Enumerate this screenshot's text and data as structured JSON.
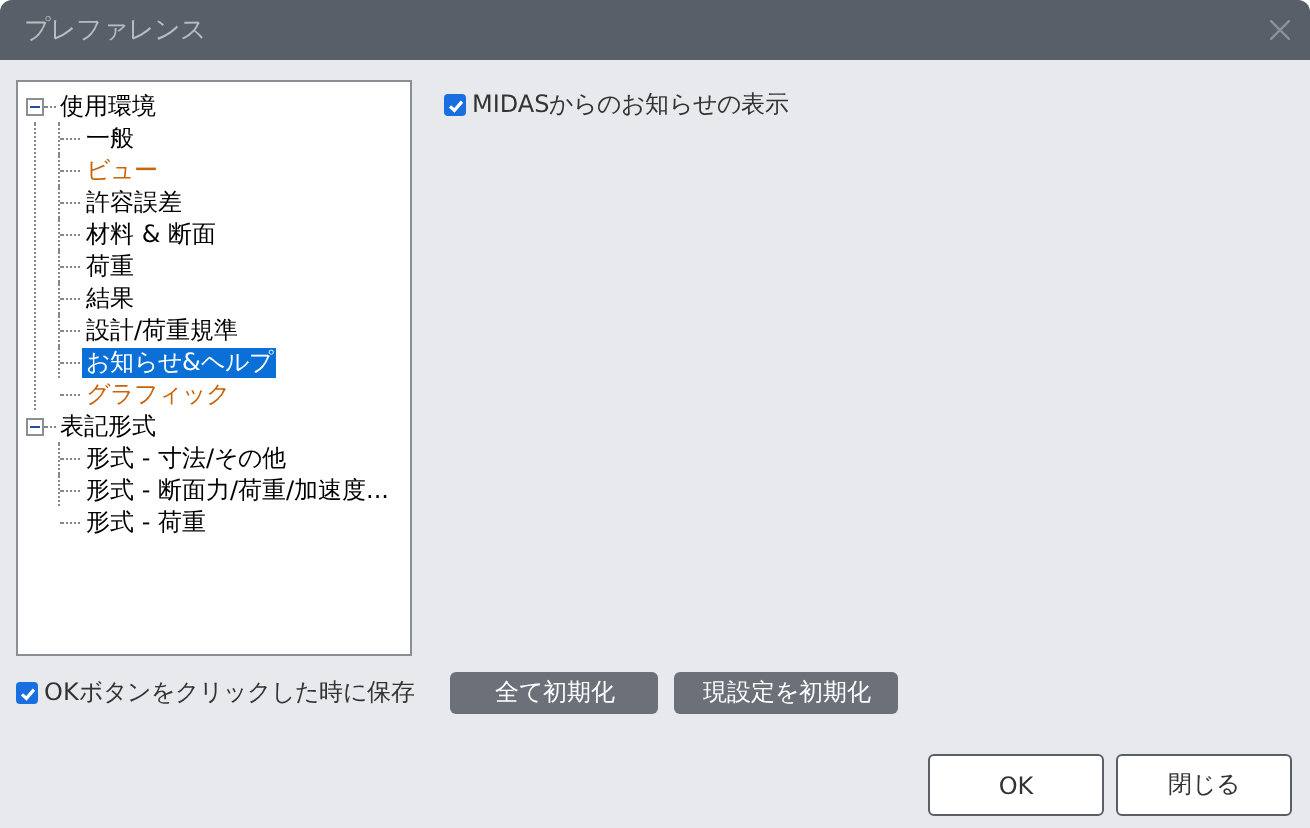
{
  "window": {
    "title": "プレファレンス"
  },
  "tree": [
    {
      "label": "使用環境",
      "expanded": true,
      "children": [
        {
          "label": "一般",
          "selected": false,
          "color": "#000000"
        },
        {
          "label": "ビュー",
          "selected": false,
          "color": "#c8640a"
        },
        {
          "label": "許容誤差",
          "selected": false,
          "color": "#000000"
        },
        {
          "label": "材料 & 断面",
          "selected": false,
          "color": "#000000"
        },
        {
          "label": "荷重",
          "selected": false,
          "color": "#000000"
        },
        {
          "label": "結果",
          "selected": false,
          "color": "#000000"
        },
        {
          "label": "設計/荷重規準",
          "selected": false,
          "color": "#000000"
        },
        {
          "label": "お知らせ&ヘルプ",
          "selected": true
        },
        {
          "label": "グラフィック",
          "selected": false,
          "color": "#c8640a"
        }
      ]
    },
    {
      "label": "表記形式",
      "expanded": true,
      "children": [
        {
          "label": "形式 - 寸法/その他",
          "selected": false,
          "color": "#000000"
        },
        {
          "label": "形式 - 断面力/荷重/加速度...",
          "selected": false,
          "color": "#000000"
        },
        {
          "label": "形式 - 荷重",
          "selected": false,
          "color": "#000000"
        }
      ]
    }
  ],
  "notice_option": {
    "label": "MIDASからのお知らせの表示",
    "checked": true
  },
  "save_option": {
    "label": "OKボタンをクリックした時に保存",
    "checked": true
  },
  "reset_buttons": [
    "全て初期化",
    "現設定を初期化"
  ],
  "buttons": [
    "OK",
    "閉じる"
  ]
}
